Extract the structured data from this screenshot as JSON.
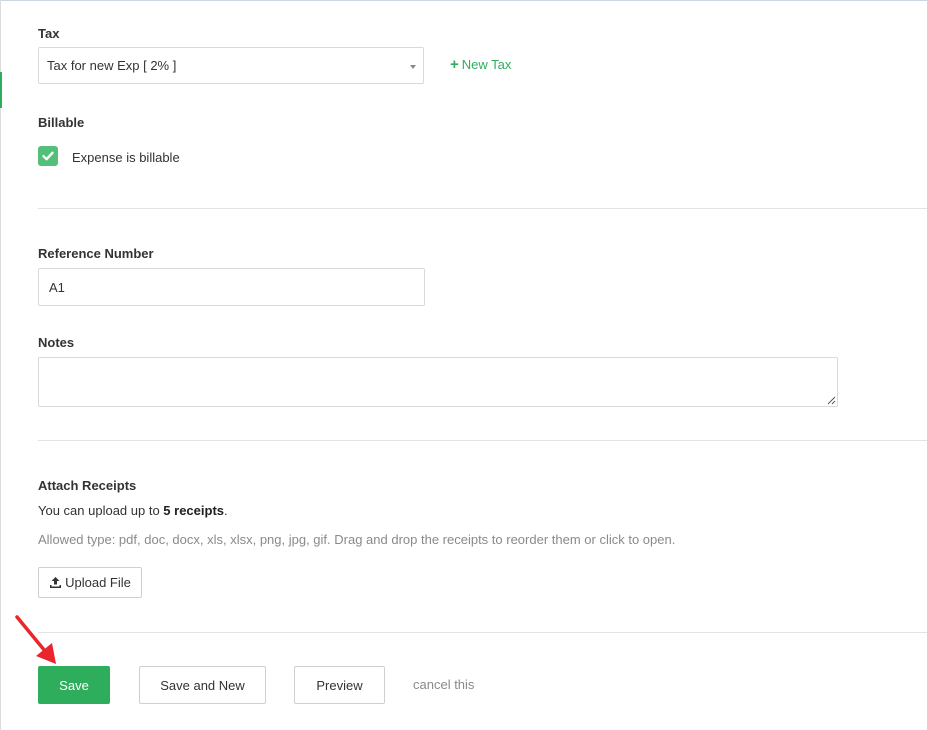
{
  "tax": {
    "label": "Tax",
    "selected": "Tax for new Exp [ 2% ]",
    "new_tax_label": "New Tax"
  },
  "billable": {
    "label": "Billable",
    "checkbox_label": "Expense is billable",
    "checked": true
  },
  "reference": {
    "label": "Reference Number",
    "value": "A1"
  },
  "notes": {
    "label": "Notes",
    "value": ""
  },
  "receipts": {
    "label": "Attach Receipts",
    "upload_prefix": "You can upload up to ",
    "upload_count": "5 receipts",
    "upload_suffix": ".",
    "allowed": "Allowed type: pdf, doc, docx, xls, xlsx, png, jpg, gif. Drag and drop the receipts to reorder them or click to open.",
    "upload_button": "Upload File"
  },
  "actions": {
    "save": "Save",
    "save_and_new": "Save and New",
    "preview": "Preview",
    "cancel": "cancel this"
  },
  "colors": {
    "primary": "#2eae5c",
    "annotation_arrow": "#e8262b"
  }
}
